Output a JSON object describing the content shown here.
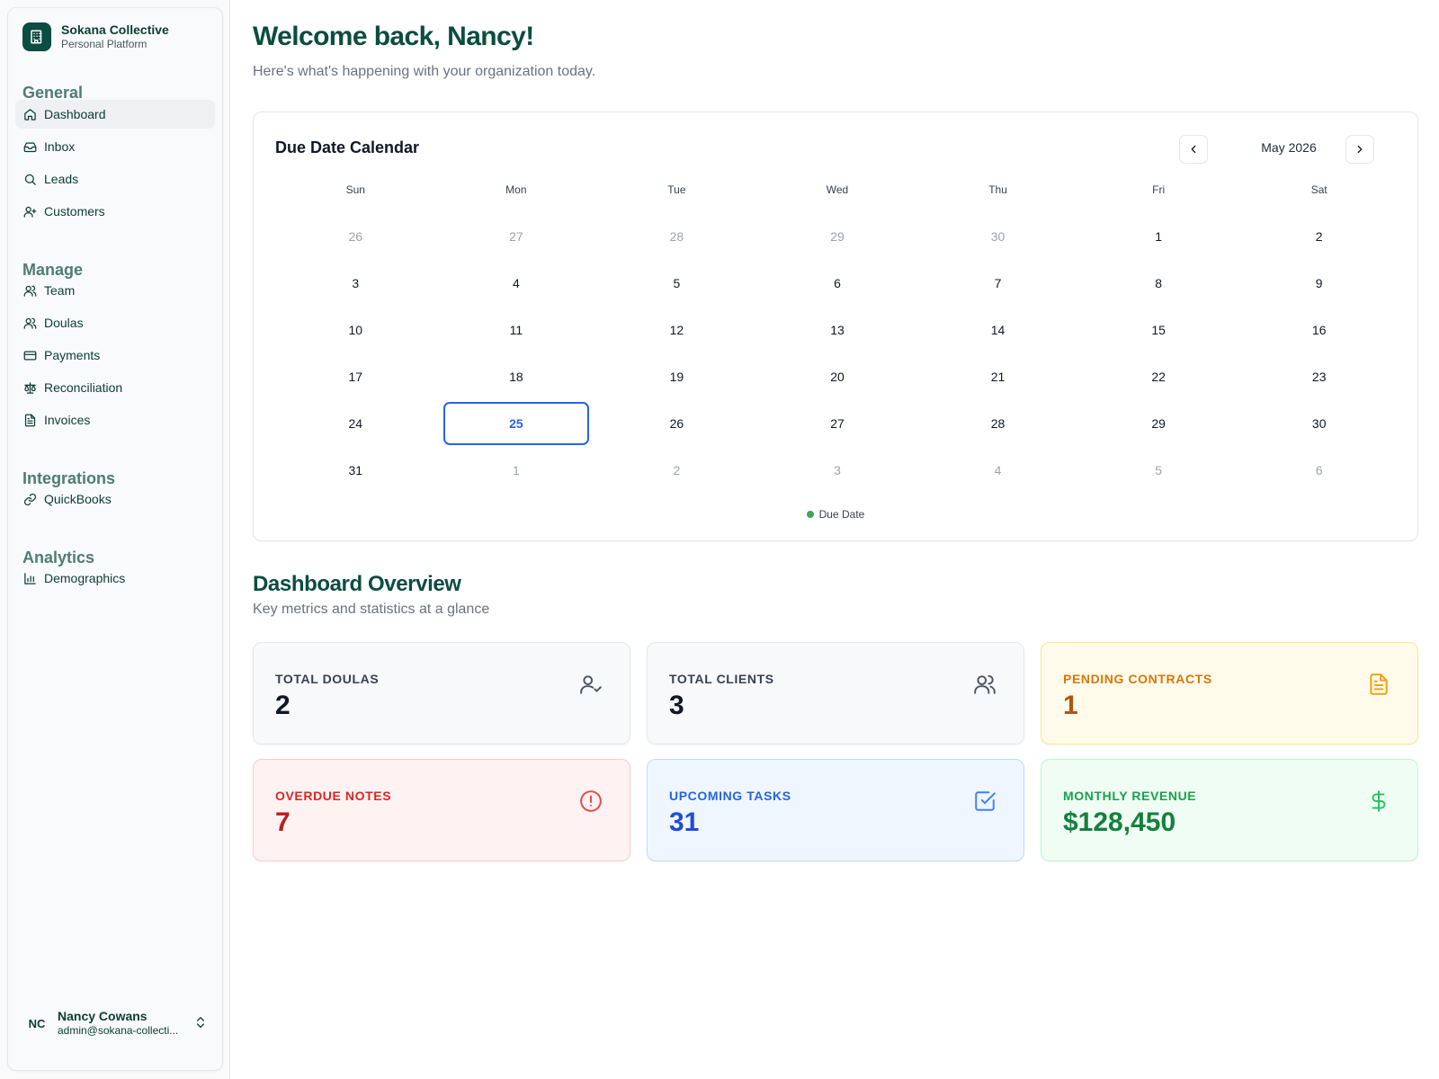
{
  "brand": {
    "name": "Sokana Collective",
    "subtitle": "Personal Platform"
  },
  "sidebar": {
    "sections": [
      {
        "title": "General",
        "items": [
          "Dashboard",
          "Inbox",
          "Leads",
          "Customers"
        ]
      },
      {
        "title": "Manage",
        "items": [
          "Team",
          "Doulas",
          "Payments",
          "Reconciliation",
          "Invoices"
        ]
      },
      {
        "title": "Integrations",
        "items": [
          "QuickBooks"
        ]
      },
      {
        "title": "Analytics",
        "items": [
          "Demographics"
        ]
      }
    ],
    "active_item": "Dashboard"
  },
  "user": {
    "initials": "NC",
    "name": "Nancy Cowans",
    "email": "admin@sokana-collecti..."
  },
  "header": {
    "welcome": "Welcome back, Nancy!",
    "subtitle": "Here's what's happening with your organization today."
  },
  "calendar": {
    "title": "Due Date Calendar",
    "month": "May 2026",
    "weekdays": [
      "Sun",
      "Mon",
      "Tue",
      "Wed",
      "Thu",
      "Fri",
      "Sat"
    ],
    "weeks": [
      [
        "26",
        "27",
        "28",
        "29",
        "30",
        "1",
        "2"
      ],
      [
        "3",
        "4",
        "5",
        "6",
        "7",
        "8",
        "9"
      ],
      [
        "10",
        "11",
        "12",
        "13",
        "14",
        "15",
        "16"
      ],
      [
        "17",
        "18",
        "19",
        "20",
        "21",
        "22",
        "23"
      ],
      [
        "24",
        "25",
        "26",
        "27",
        "28",
        "29",
        "30"
      ],
      [
        "31",
        "1",
        "2",
        "3",
        "4",
        "5",
        "6"
      ]
    ],
    "today": "25",
    "legend": "Due Date",
    "legend_color": "#3fa35b"
  },
  "overview": {
    "title": "Dashboard Overview",
    "subtitle": "Key metrics and statistics at a glance",
    "stats": [
      {
        "label": "TOTAL DOULAS",
        "value": "2",
        "icon": "user-check-icon"
      },
      {
        "label": "TOTAL CLIENTS",
        "value": "3",
        "icon": "users-icon"
      },
      {
        "label": "PENDING CONTRACTS",
        "value": "1",
        "icon": "file-text-icon"
      },
      {
        "label": "OVERDUE NOTES",
        "value": "7",
        "icon": "alert-circle-icon"
      },
      {
        "label": "UPCOMING TASKS",
        "value": "31",
        "icon": "check-square-icon"
      },
      {
        "label": "MONTHLY REVENUE",
        "value": "$128,450",
        "icon": "dollar-sign-icon"
      }
    ]
  },
  "colors": {
    "brand": "#0b4d40",
    "section_title": "#4d7d73",
    "today_border": "#2563eb",
    "neutral_card_bg": "#f8f9fb",
    "pending_bg": "#fffbeb",
    "pending_text": "#d97706",
    "pending_value": "#b45309",
    "overdue_bg": "#fef2f2",
    "overdue_text": "#dc2626",
    "overdue_value": "#b91c1c",
    "tasks_bg": "#eff6ff",
    "tasks_text": "#2563eb",
    "tasks_value": "#1d4ed8",
    "revenue_bg": "#f0fdf4",
    "revenue_text": "#16a34a",
    "revenue_value": "#15803d"
  }
}
